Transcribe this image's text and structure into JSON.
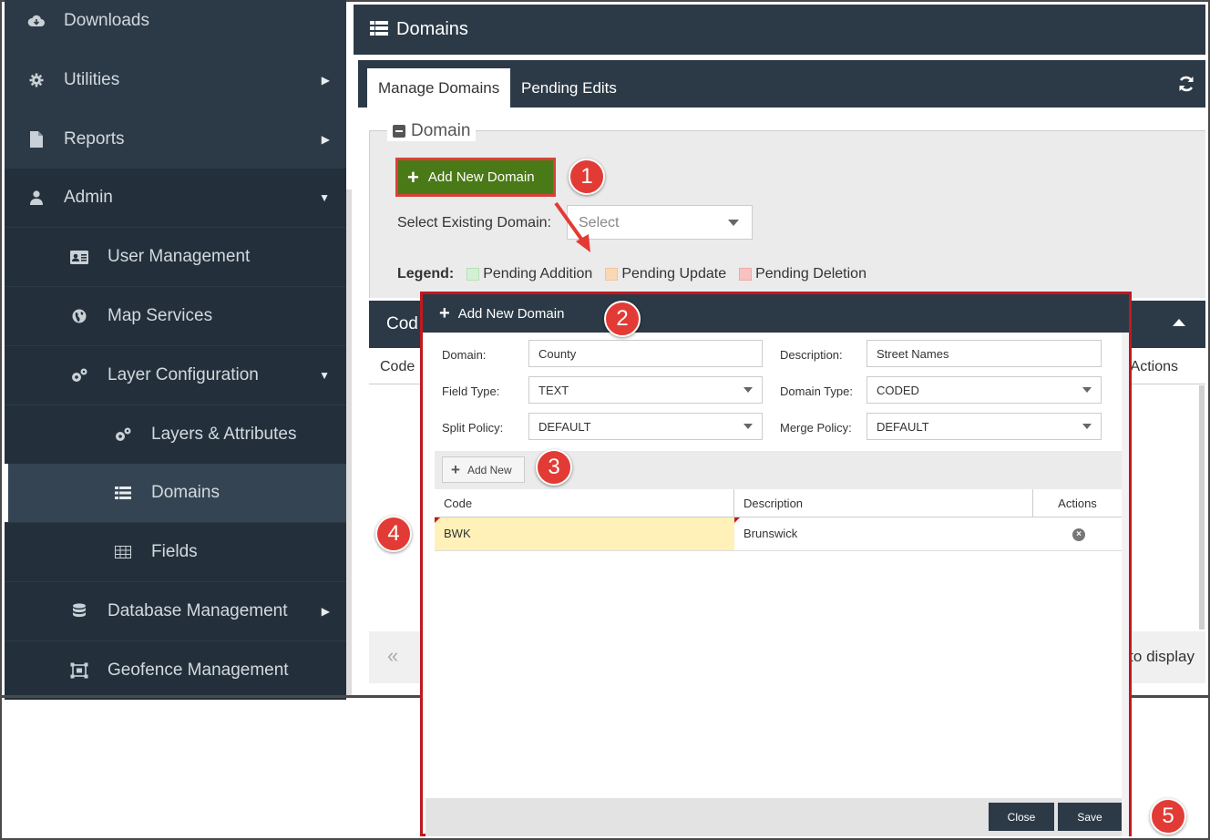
{
  "sidebar": {
    "items": [
      {
        "label": "Downloads",
        "icon": "cloud-download-icon",
        "arrow": ""
      },
      {
        "label": "Utilities",
        "icon": "gear-icon",
        "arrow": "▶"
      },
      {
        "label": "Reports",
        "icon": "file-icon",
        "arrow": "▶"
      },
      {
        "label": "Admin",
        "icon": "user-icon",
        "arrow": "▼"
      },
      {
        "label": "User Management",
        "icon": "id-card-icon",
        "arrow": ""
      },
      {
        "label": "Map Services",
        "icon": "globe-icon",
        "arrow": ""
      },
      {
        "label": "Layer Configuration",
        "icon": "gears-icon",
        "arrow": "▼"
      },
      {
        "label": "Layers & Attributes",
        "icon": "gears-icon",
        "arrow": ""
      },
      {
        "label": "Domains",
        "icon": "list-icon",
        "arrow": ""
      },
      {
        "label": "Fields",
        "icon": "table-icon",
        "arrow": ""
      },
      {
        "label": "Database Management",
        "icon": "database-icon",
        "arrow": "▶"
      },
      {
        "label": "Geofence Management",
        "icon": "geofence-icon",
        "arrow": ""
      }
    ]
  },
  "header": {
    "title": "Domains",
    "icon": "list-icon"
  },
  "tabs": {
    "manage": "Manage Domains",
    "pending": "Pending Edits",
    "refresh_icon": "refresh-icon"
  },
  "domain_section": {
    "legend_title": "Domain",
    "add_button": "Add New Domain",
    "select_label": "Select Existing Domain:",
    "select_placeholder": "Select",
    "legend_label": "Legend:",
    "legend_items": [
      {
        "label": "Pending Addition",
        "color": "#d4f0d4"
      },
      {
        "label": "Pending Update",
        "color": "#fad7b5"
      },
      {
        "label": "Pending Deletion",
        "color": "#f7c2c2"
      }
    ]
  },
  "grid": {
    "header_title": "Cod",
    "col_code": "Code",
    "col_actions": "Actions",
    "footer_first": "«",
    "footer_msg": "to display"
  },
  "modal": {
    "title": "Add New Domain",
    "domain_label": "Domain:",
    "domain_value": "County",
    "description_label": "Description:",
    "description_value": "Street Names",
    "field_type_label": "Field Type:",
    "field_type_value": "TEXT",
    "domain_type_label": "Domain Type:",
    "domain_type_value": "CODED",
    "split_policy_label": "Split Policy:",
    "split_policy_value": "DEFAULT",
    "merge_policy_label": "Merge Policy:",
    "merge_policy_value": "DEFAULT",
    "add_new": "Add New",
    "columns": {
      "code": "Code",
      "description": "Description",
      "actions": "Actions"
    },
    "rows": [
      {
        "code": "BWK",
        "description": "Brunswick"
      }
    ],
    "close": "Close",
    "save": "Save"
  },
  "callouts": [
    "1",
    "2",
    "3",
    "4",
    "5"
  ],
  "colors": {
    "sidebar": "#2c3a47",
    "accent_green": "#4a7a17",
    "highlight_red": "#c0191f",
    "callout": "#e23b35"
  }
}
